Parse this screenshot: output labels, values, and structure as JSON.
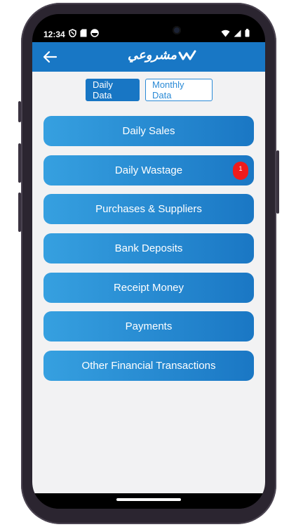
{
  "status": {
    "time": "12:34"
  },
  "app": {
    "logo_text": "مشروعي"
  },
  "tabs": [
    {
      "label": "Daily Data",
      "active": true
    },
    {
      "label": "Monthly Data",
      "active": false
    }
  ],
  "menu": [
    {
      "label": "Daily Sales"
    },
    {
      "label": "Daily Wastage",
      "badge": "1"
    },
    {
      "label": "Purchases & Suppliers"
    },
    {
      "label": "Bank Deposits"
    },
    {
      "label": "Receipt Money"
    },
    {
      "label": "Payments"
    },
    {
      "label": "Other Financial Transactions"
    }
  ],
  "colors": {
    "app_bar": "#1877c5",
    "accent": "#1876c4",
    "badge": "#f01b1b",
    "background": "#f2f2f3"
  }
}
